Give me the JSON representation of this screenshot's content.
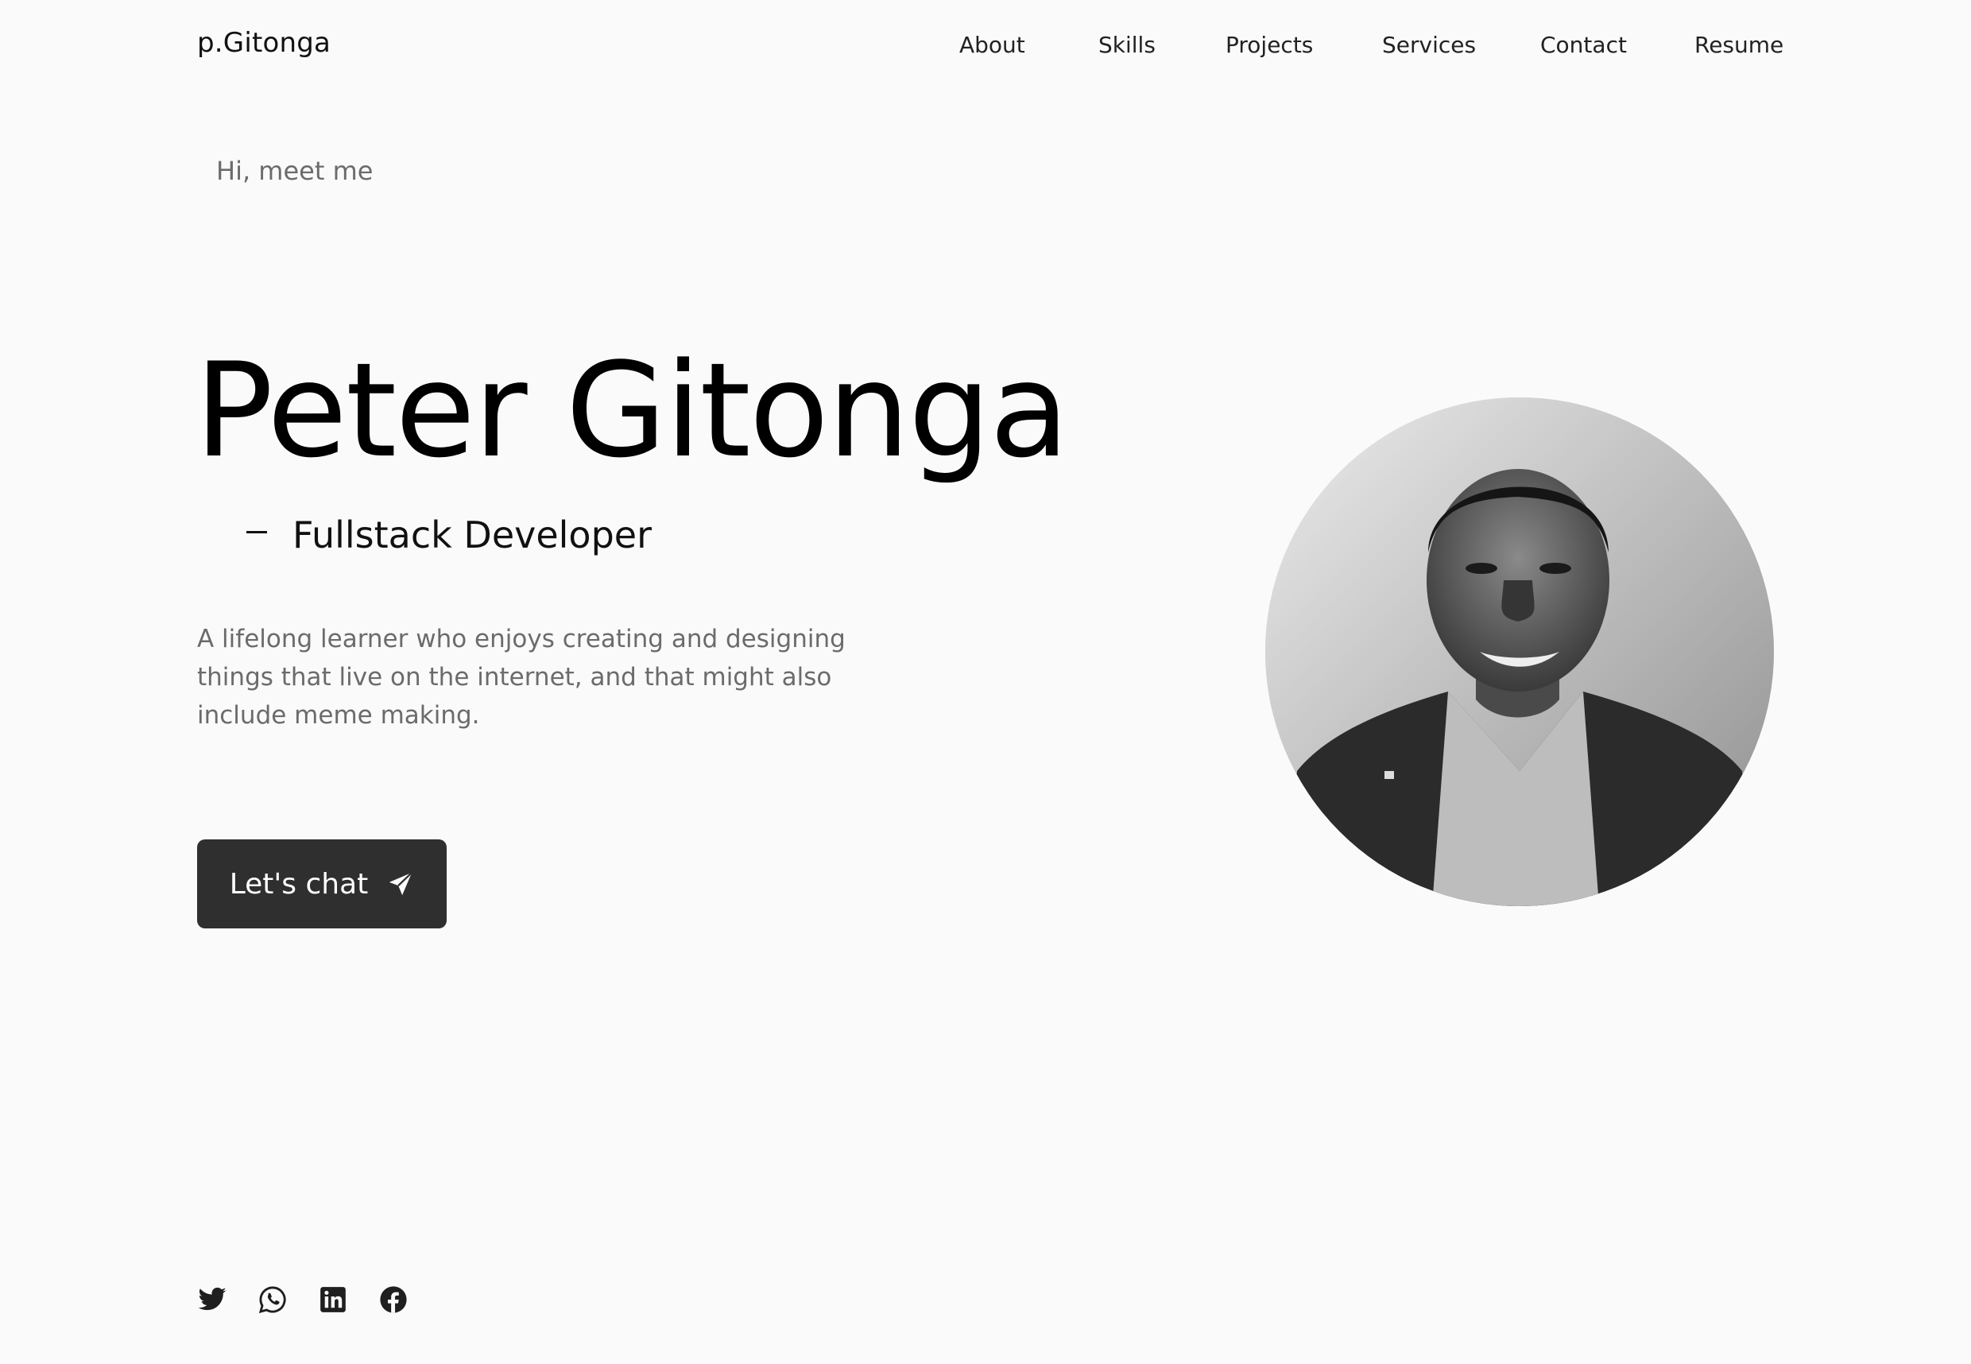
{
  "header": {
    "brand": "p.Gitonga",
    "nav": [
      "About",
      "Skills",
      "Projects",
      "Services",
      "Contact",
      "Resume"
    ]
  },
  "hero": {
    "greeting": "Hi, meet me",
    "name": "Peter Gitonga",
    "role": "Fullstack Developer",
    "bio": "A lifelong learner who enjoys creating and designing things that live on the internet, and that might also include meme making.",
    "cta_label": "Let's chat",
    "cta_icon": "send-icon"
  },
  "portrait": {
    "icon": "profile-photo"
  },
  "socials": [
    "twitter-icon",
    "whatsapp-icon",
    "linkedin-icon",
    "facebook-icon"
  ],
  "colors": {
    "background": "#fafafa",
    "text": "#000000",
    "muted": "#6b6b6b",
    "button": "#2f2f2f"
  }
}
